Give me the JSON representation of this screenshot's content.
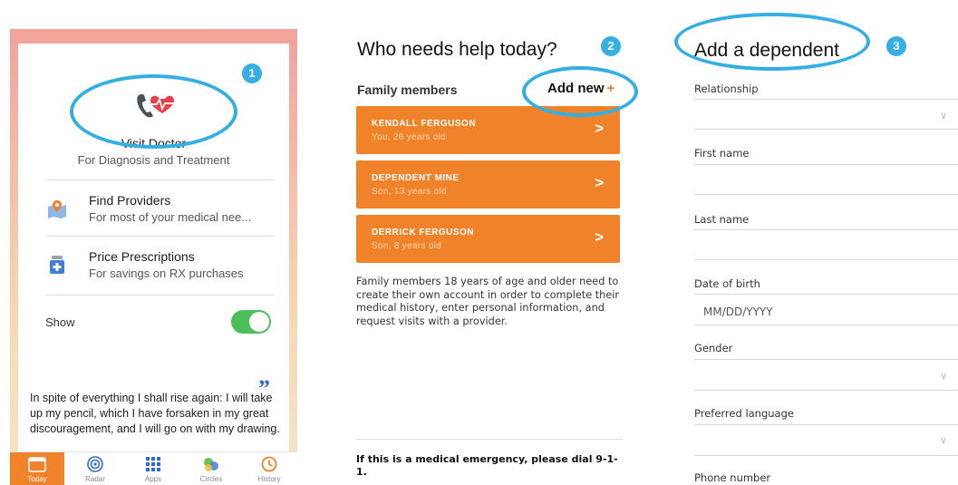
{
  "panel1": {
    "visit_doctor": {
      "title": "Visit Doctor",
      "subtitle": "For Diagnosis and Treatment"
    },
    "rows": [
      {
        "title": "Find Providers",
        "subtitle": "For most of your medical nee...",
        "icon": "map-pin-icon"
      },
      {
        "title": "Price Prescriptions",
        "subtitle": "For savings on RX purchases",
        "icon": "pill-bottle-icon"
      }
    ],
    "show_label": "Show",
    "show_toggle_on": true,
    "quote": "In spite of everything I shall rise again: I will take up my pencil, which I have forsaken in my great discouragement, and I will go on with my drawing.",
    "tabs": [
      {
        "label": "Today",
        "icon": "calendar-icon",
        "active": true
      },
      {
        "label": "Radar",
        "icon": "radar-icon",
        "active": false
      },
      {
        "label": "Apps",
        "icon": "apps-grid-icon",
        "active": false
      },
      {
        "label": "Circles",
        "icon": "circles-icon",
        "active": false
      },
      {
        "label": "History",
        "icon": "history-icon",
        "active": false
      }
    ]
  },
  "panel2": {
    "title": "Who needs help today?",
    "section_label": "Family members",
    "add_new_label": "Add new",
    "add_new_plus": "+",
    "members": [
      {
        "name": "KENDALL FERGUSON",
        "detail": "You, 26 years old"
      },
      {
        "name": "DEPENDENT MINE",
        "detail": "Son, 13 years old"
      },
      {
        "name": "DERRICK FERGUSON",
        "detail": "Son, 8 years old"
      }
    ],
    "chevron": ">",
    "note": "Family members 18 years of age and older need to create their own account in order to complete their medical history, enter personal information, and request visits with a provider.",
    "emergency": "If this is a medical emergency, please dial 9-1-1."
  },
  "panel3": {
    "title": "Add a dependent",
    "fields": [
      {
        "label": "Relationship",
        "value": "",
        "dropdown": true
      },
      {
        "label": "First name",
        "value": "",
        "dropdown": false
      },
      {
        "label": "Last name",
        "value": "",
        "dropdown": false
      },
      {
        "label": "Date of birth",
        "value": "MM/DD/YYYY",
        "dropdown": false
      },
      {
        "label": "Gender",
        "value": "",
        "dropdown": true
      },
      {
        "label": "Preferred language",
        "value": "",
        "dropdown": true
      },
      {
        "label": "Phone number",
        "value": "",
        "dropdown": false
      }
    ]
  },
  "annotations": [
    "1",
    "2",
    "3"
  ],
  "colors": {
    "accent_orange": "#f0832a",
    "annotation_blue": "#35aee4",
    "toggle_green": "#4cbf5a",
    "heart_red": "#e8414c"
  }
}
